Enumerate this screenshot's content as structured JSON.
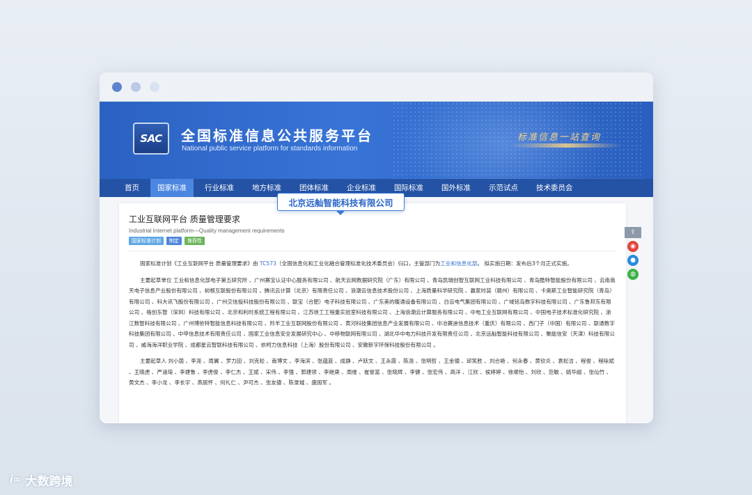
{
  "site": {
    "title": "全国标准信息公共服务平台",
    "subtitle": "National public service platform  for standards information",
    "logo_text": "SAC",
    "slogan": "标准信息一站查询"
  },
  "nav": {
    "items": [
      "首页",
      "国家标准",
      "行业标准",
      "地方标准",
      "团体标准",
      "企业标准",
      "国际标准",
      "国外标准",
      "示范试点",
      "技术委员会"
    ],
    "active_index": 1
  },
  "doc": {
    "title": "工业互联网平台 质量管理要求",
    "title_en": "Industrial Internet platform—Quality management requirements",
    "tags": [
      "国家标准计划",
      "制定",
      "推荐性"
    ],
    "intro_prefix": "国家标准计划《工业互联网平台 质量管理要求》由 ",
    "tc_link": "TC573",
    "intro_mid": "（全国信息化和工业化融合管理标准化技术委员会）归口，主管部门为",
    "dept_link": "工业和信息化部",
    "intro_suffix": "。 拟实施日期：发布后3个月正式实施。",
    "units_label": "主要起草单位",
    "units": "工业和信息化部电子第五研究所 、广州赛宝认证中心服务有限公司 、航天云网数据研究院（广东）有限公司 、青岛凯瑞创智互联网工业科技有限公司 、青岛酷特智能股份有限公司 、云南南天电子信息产业股份有限公司 、树根互联股份有限公司 、腾讯云计算（北京）有限责任公司 、浪潮云信息技术股份公司 、上海质量科学研究院 、赢家时装（赣州）有限公司 、卡奥斯工业智能研究院（青岛）有限公司 、科大讯飞股份有限公司 、广州交信投科技股份有限公司 、联宝（合肥）电子科技有限公司 、广东美的暖通设备有限公司 、白云电气集团有限公司 、广域铭岛数字科技有限公司 、广东鲁邦东有限公司 、格创东智（深圳）科技有限公司 、北京和利时系统工程有限公司 、江苏徐工工程重实验室科技有限公司 、上海浪潮云计算服务有限公司 、中电工业互联网有限公司 、中国电子技术标准化研究院 、浙江数智科技有限公司 、广州博依特智能信息科技有限公司 、羚羊工业互联网股份有限公司 、黄河科技集团信息产业发展有限公司 、中冶赛迪信息技术（重庆）有限公司 、西门子（中国）有限公司 、联通数字科技集团有限公司 、中甲信息技术有限责任公司 、国家工业信息安全发展研究中心 、中移物联网有限公司 、湖北华中电力科技开发有限责任公司 、北京远舢智能科技有限公司 、聚能信安（天津）科技有限公司 、威海海洋职业学院 、成都星云智联科技有限公司 、依柯力信息科技（上海）股份有限公司 、安徽新宇环保科技股份有限公司 。",
    "people_label": "主要起草人",
    "people": "刘小茵 、李尧 、周翼 、罗力田 、刘克松 、南博文 、李海滨 、张蕴蓝 、成静 、卢跃文 、王永霞 、陈尧 、张明哲 、王金德 、邱笑胜 、刘合艳 、何永春 、黄钦炎 、袁松洁 、程俊 、程咏斌 、王晓虎 、严涵琦 、李建鲁 、李虎俊 、李仁杰 、王斌 、宋伟 、李强 、郭建领 、李继庚 、周维 、崔俊富 、张晓辉 、李健 、张宏伟 、高洋 、江欣 、侯婷婷 、徐顺怡 、刘欣 、范敏 、姚华超 、张仙竹 、黄文杰 、李小龙 、李长宇 、燕居怀 、何礼仁 、尹可杰 、张友德 、陈录城 、盛国军 。"
  },
  "tooltip": {
    "text": "北京远舢智能科技有限公司"
  },
  "share": {
    "top_icon": "share-icon",
    "icons": [
      "weibo-icon",
      "qq-icon",
      "wechat-icon"
    ]
  },
  "watermark": {
    "logo": "i∞",
    "text": "大数跨境"
  },
  "colors": {
    "banner": "#3874d6",
    "nav": "#2452a4",
    "nav_active": "#4b86e0",
    "link": "#2f6fc8"
  }
}
